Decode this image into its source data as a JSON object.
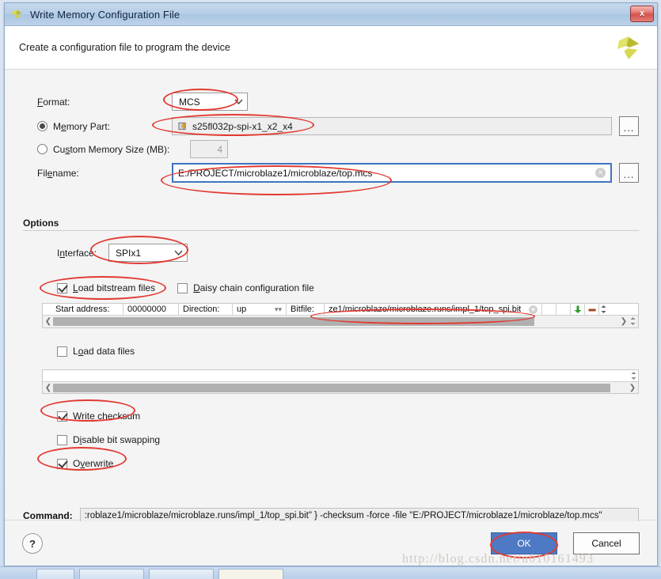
{
  "window": {
    "title": "Write Memory Configuration File",
    "close_label": "x",
    "header_text": "Create a configuration file to program the device"
  },
  "form": {
    "format_label": "Format:",
    "format_value": "MCS",
    "memory_part_label": "Memory Part:",
    "memory_part_value": "s25fl032p-spi-x1_x2_x4",
    "custom_size_label": "Custom Memory Size (MB):",
    "custom_size_value": "4",
    "filename_label": "Filename:",
    "filename_value": "E:/PROJECT/microblaze1/microblaze/top.mcs",
    "browse_label": "...",
    "clear_label": "×"
  },
  "options": {
    "group_title": "Options",
    "interface_label": "Interface:",
    "interface_value": "SPIx1",
    "load_bitstream_label": "Load bitstream files",
    "daisy_chain_label": "Daisy chain configuration file",
    "load_data_label": "Load data files",
    "write_checksum_label": "Write checksum",
    "disable_bit_swapping_label": "Disable bit swapping",
    "overwrite_label": "Overwrite"
  },
  "bitstream_table": {
    "columns": [
      "Start address:",
      "Direction:",
      "Bitfile:"
    ],
    "start_address": "00000000",
    "direction": "up",
    "bitfile": "ze1/microblaze/microblaze.runs/impl_1/top_spi.bit",
    "add_icon": "add-row-icon",
    "remove_icon": "remove-row-icon",
    "spinner_icon": "spinner-icon"
  },
  "command": {
    "label": "Command:",
    "value": ":roblaze1/microblaze/microblaze.runs/impl_1/top_spi.bit\" } -checksum -force -file \"E:/PROJECT/microblaze1/microblaze/top.mcs\""
  },
  "footer": {
    "help_label": "?",
    "ok_label": "OK",
    "cancel_label": "Cancel"
  },
  "watermark": {
    "text": "http://blog.csdn.net/u010161493"
  },
  "colors": {
    "accent": "#4e79c4",
    "annotation": "#e23a32",
    "titlebar": "#b7cee6",
    "close": "#d5534c"
  }
}
